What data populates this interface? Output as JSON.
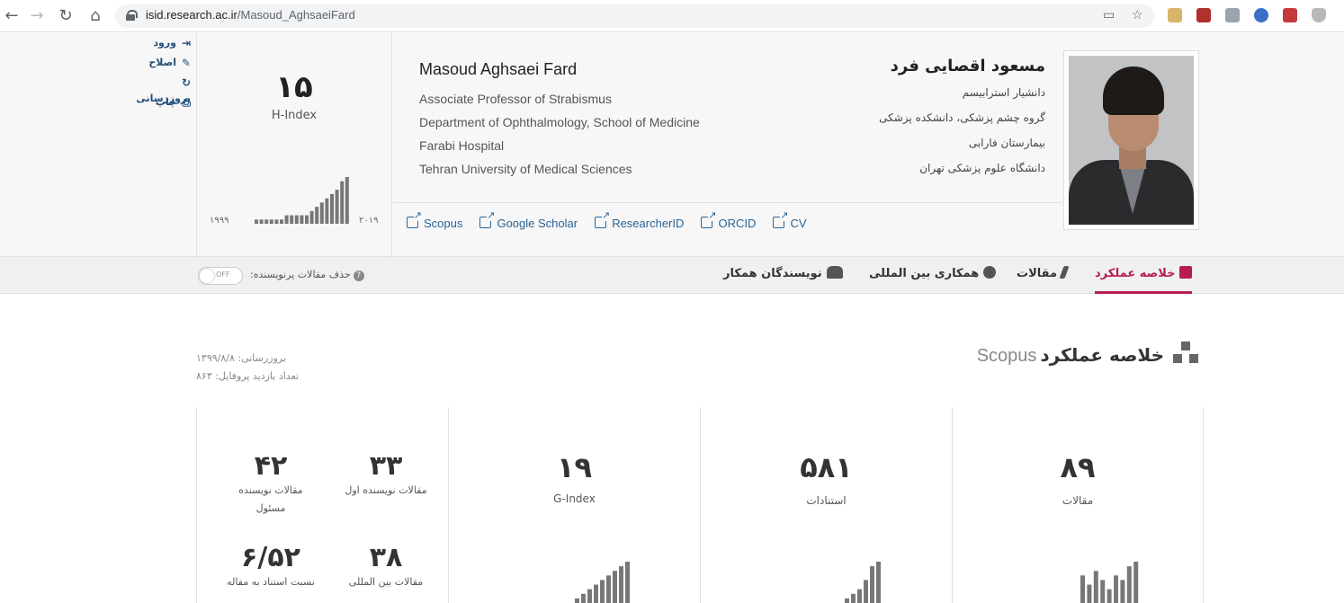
{
  "browser": {
    "url_host": "isid.research.ac.ir",
    "url_path": "/Masoud_AghsaeiFard"
  },
  "side_links": [
    "ورود",
    "اصلاح",
    "بروزرسانی",
    "چاپ"
  ],
  "hindex_box": {
    "value": "۱۵",
    "label": "H-Index",
    "year_start": "۱۹۹۹",
    "year_end": "۲۰۱۹",
    "sparkline": [
      1,
      1,
      1,
      1,
      1,
      1,
      2,
      2,
      2,
      2,
      2,
      3,
      4,
      5,
      6,
      7,
      8,
      10,
      11
    ]
  },
  "profile_en": {
    "name": "Masoud Aghsaei Fard",
    "lines": [
      "Associate Professor of Strabismus",
      "Department of Ophthalmology, School of Medicine",
      "Farabi Hospital",
      "Tehran University of Medical Sciences"
    ]
  },
  "profile_fa": {
    "name": "مسعود اقصایی فرد",
    "lines": [
      "دانشیار استرابیسم",
      "گروه چشم پزشکی، دانشکده پزشکی",
      "بیمارستان فارابی",
      "دانشگاه علوم پزشکی تهران"
    ]
  },
  "external_links": [
    "Scopus",
    "Google Scholar",
    "ResearcherID",
    "ORCID",
    "CV"
  ],
  "tabs": [
    "خلاصه عملکرد",
    "مقالات",
    "همکاری بین المللی",
    "نویسندگان همکار"
  ],
  "toggle": {
    "state": "OFF",
    "label": "حذف مقالات پرنویسنده:"
  },
  "summary": {
    "title": "خلاصه عملکرد",
    "source": "Scopus",
    "updated": "بروزرسانی: ۱۳۹۹/۸/۸",
    "views": "تعداد بازدید پروفایل: ۸۶۳"
  },
  "stats": {
    "articles": {
      "value": "۸۹",
      "label": "مقالات"
    },
    "citations": {
      "value": "۵۸۱",
      "label": "استنادات"
    },
    "gindex": {
      "value": "۱۹",
      "label": "G-Index"
    },
    "first_author": {
      "value": "۳۳",
      "label": "مقالات نویسنده اول"
    },
    "corresponding": {
      "value": "۴۲",
      "label": "مقالات نویسنده مسئول"
    },
    "international": {
      "value": "۳۸",
      "label": "مقالات بین المللی"
    },
    "cites_per_article": {
      "value": "۶/۵۲",
      "label": "نسبت استناد به مقاله"
    }
  },
  "mini_bars": {
    "articles": [
      6,
      4,
      7,
      5,
      3,
      6,
      5,
      8,
      9
    ],
    "citations": [
      1,
      2,
      3,
      5,
      8,
      9
    ],
    "gindex": [
      1,
      2,
      3,
      4,
      5,
      6,
      7,
      8,
      9
    ]
  }
}
